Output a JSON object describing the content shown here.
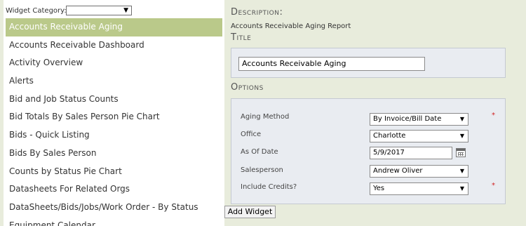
{
  "widget_category": {
    "label": "Widget Category:",
    "selected": ""
  },
  "widgets": [
    {
      "label": "Accounts Receivable Aging",
      "selected": true
    },
    {
      "label": "Accounts Receivable Dashboard"
    },
    {
      "label": "Activity Overview"
    },
    {
      "label": "Alerts"
    },
    {
      "label": "Bid and Job Status Counts"
    },
    {
      "label": "Bid Totals By Sales Person Pie Chart"
    },
    {
      "label": "Bids - Quick Listing"
    },
    {
      "label": "Bids By Sales Person"
    },
    {
      "label": "Counts by Status Pie Chart"
    },
    {
      "label": "Datasheets For Related Orgs"
    },
    {
      "label": "DataSheets/Bids/Jobs/Work Order - By Status"
    },
    {
      "label": "Equipment Calendar"
    }
  ],
  "description": {
    "heading": "Description:",
    "text": "Accounts Receivable Aging Report"
  },
  "title_section": {
    "heading": "Title",
    "value": "Accounts Receivable Aging"
  },
  "options": {
    "heading": "Options",
    "aging_method": {
      "label": "Aging Method",
      "value": "By Invoice/Bill Date",
      "required": "*"
    },
    "office": {
      "label": "Office",
      "value": "Charlotte"
    },
    "as_of_date": {
      "label": "As Of Date",
      "value": "5/9/2017"
    },
    "salesperson": {
      "label": "Salesperson",
      "value": "Andrew Oliver"
    },
    "include_credits": {
      "label": "Include Credits?",
      "value": "Yes",
      "required": "*"
    }
  },
  "add_widget_button": "Add Widget",
  "colors": {
    "selected_item_bg": "#bac98a",
    "page_bg": "#e8ecdc",
    "panel_bg": "#e9ecf1",
    "required": "#d02020"
  }
}
